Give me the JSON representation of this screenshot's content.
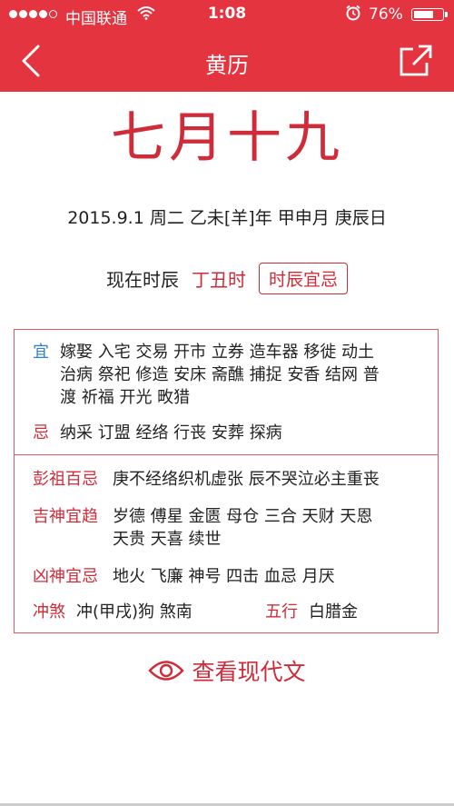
{
  "status_bar": {
    "carrier": "中国联通",
    "time": "1:08",
    "battery_percent": "76%",
    "battery_level": 0.76,
    "signal_bars": 4,
    "signal_total": 5
  },
  "nav": {
    "title": "黄历",
    "back_icon": "chevron-left-icon",
    "share_icon": "share-out-icon"
  },
  "lunar_date": "七月十九",
  "gregorian_line": "2015.9.1 周二 乙未[羊]年 甲申月 庚辰日",
  "shichen": {
    "label": "现在时辰",
    "value": "丁丑时",
    "button": "时辰宜忌"
  },
  "almanac": {
    "yi_label": "宜",
    "yi_lines": [
      "嫁娶 入宅 交易 开市 立券 造车器 移徙 动土",
      "治病 祭祀 修造 安床 斋醮 捕捉 安香 结网 普",
      "渡 祈福 开光 畋猎"
    ],
    "ji_label": "忌",
    "ji": "纳采 订盟 经络 行丧 安葬 探病",
    "pengzu_label": "彭祖百忌",
    "pengzu": "庚不经络织机虚张 辰不哭泣必主重丧",
    "jishen_label": "吉神宜趋",
    "jishen_lines": [
      "岁德 傅星 金匮 母仓 三合 天财 天恩",
      "天贵 天喜 续世"
    ],
    "xiongshen_label": "凶神宜忌",
    "xiongshen": "地火 飞廉 神号 四击 血忌 月厌",
    "chongsha_label": "冲煞",
    "chongsha": "冲(甲戌)狗 煞南",
    "wuxing_label": "五行",
    "wuxing": "白腊金"
  },
  "modern_text_button": "查看现代文",
  "colors": {
    "brand_red": "#e4343f",
    "text_red": "#d02b39",
    "label_blue": "#2f7fcf"
  }
}
